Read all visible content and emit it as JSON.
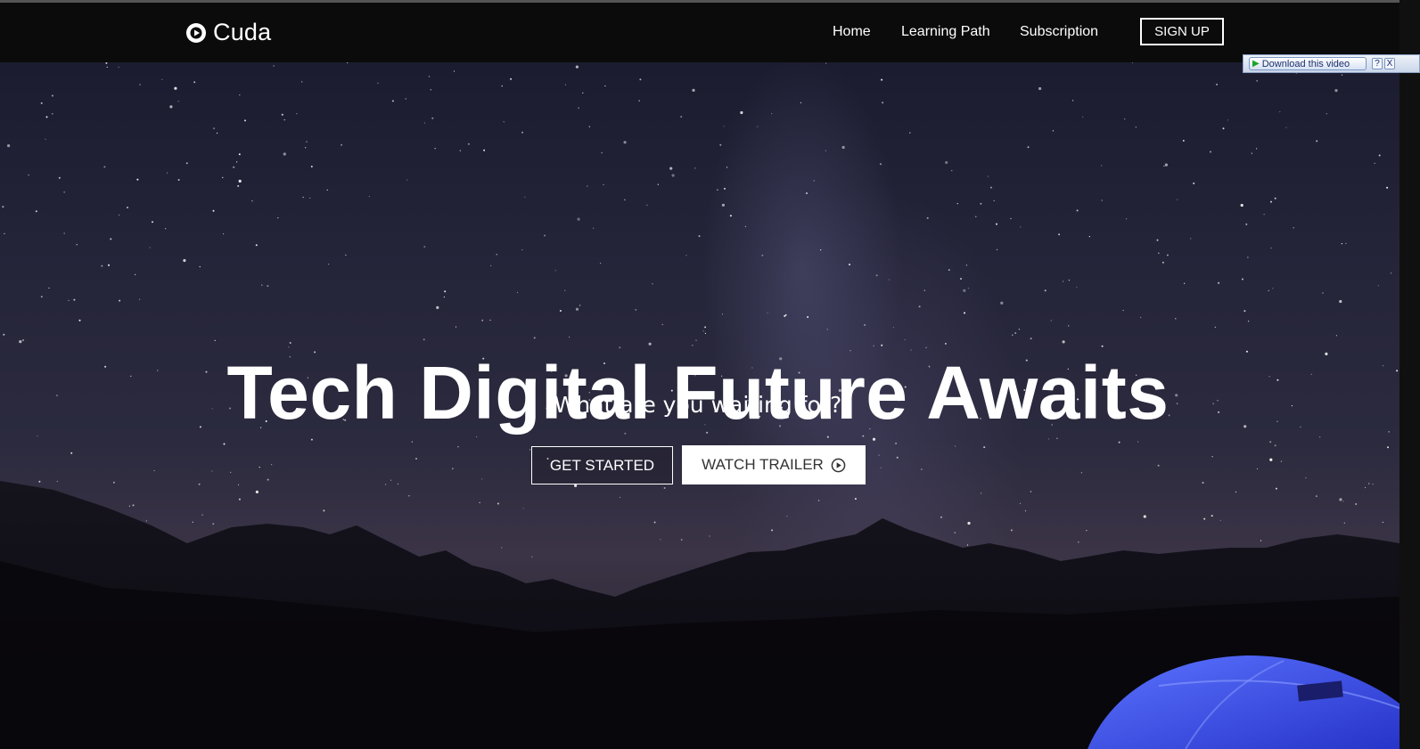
{
  "nav": {
    "brand": "Cuda",
    "links": [
      "Home",
      "Learning Path",
      "Subscription"
    ],
    "signup": "SIGN UP"
  },
  "hero": {
    "title": "Tech Digital Future Awaits",
    "subtitle": "What are you waiting for?",
    "primary_button": "GET STARTED",
    "secondary_button": "WATCH TRAILER"
  },
  "download_bar": {
    "label": "Download this video",
    "help": "?",
    "close": "X"
  },
  "icons": {
    "logo": "play-circle-icon",
    "trailer": "play-circle-icon",
    "download": "play-triangle-icon"
  },
  "colors": {
    "navbar": "#0b0b0b",
    "sky": "#25253a",
    "tent": "#3446e8",
    "text": "#ffffff"
  }
}
